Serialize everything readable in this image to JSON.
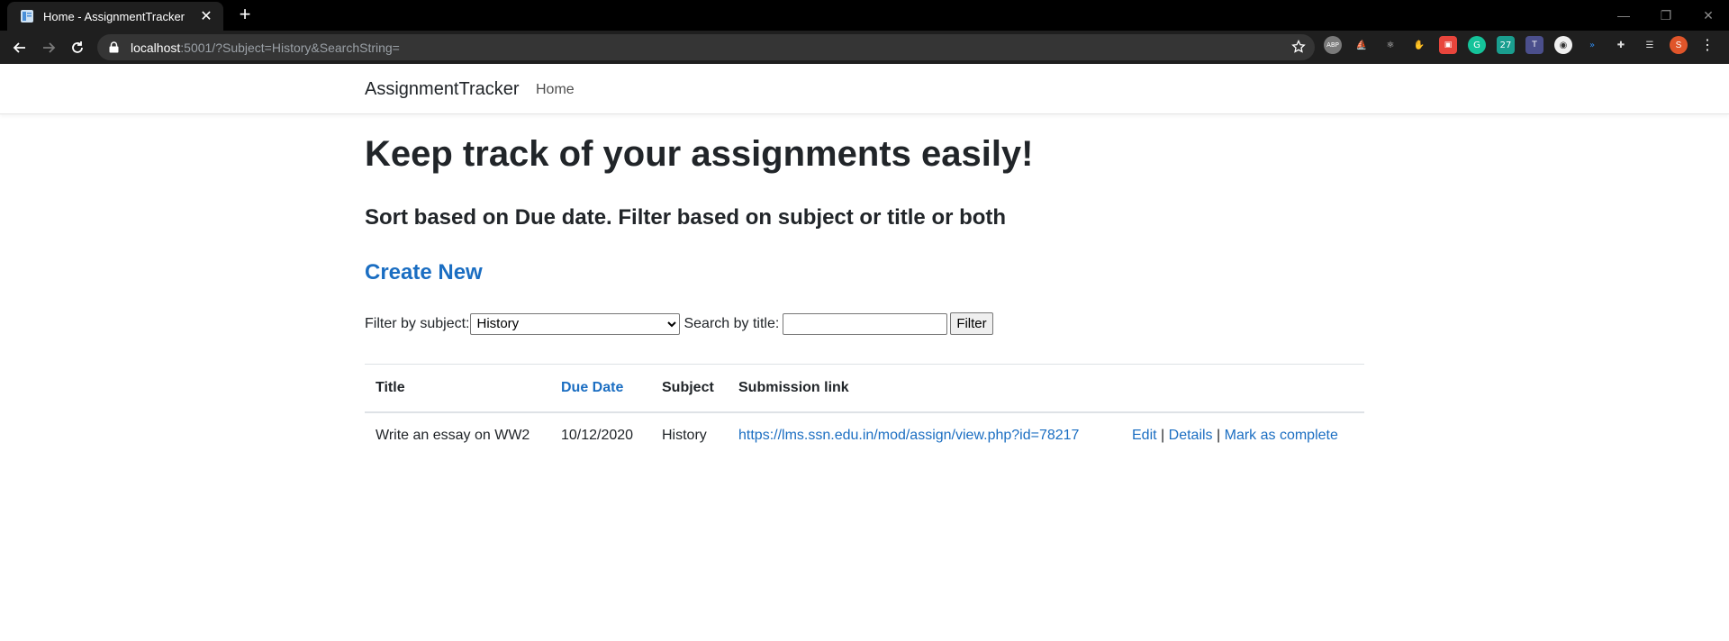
{
  "browser": {
    "tab_title": "Home - AssignmentTracker",
    "url_host": "localhost",
    "url_rest": ":5001/?Subject=History&SearchString=",
    "profile_initial": "S"
  },
  "navbar": {
    "brand": "AssignmentTracker",
    "home": "Home"
  },
  "page": {
    "heading": "Keep track of your assignments easily!",
    "subheading": "Sort based on Due date. Filter based on subject or title or both",
    "create_new": "Create New"
  },
  "filter": {
    "subject_label": "Filter by subject:",
    "subject_selected": "History",
    "title_label": "Search by title:",
    "title_value": "",
    "button": "Filter"
  },
  "table": {
    "headers": {
      "title": "Title",
      "due_date": "Due Date",
      "subject": "Subject",
      "submission_link": "Submission link"
    },
    "rows": [
      {
        "title": "Write an essay on WW2",
        "due_date": "10/12/2020",
        "subject": "History",
        "link": "https://lms.ssn.edu.in/mod/assign/view.php?id=78217",
        "edit": "Edit",
        "sep1": "|",
        "details": "Details",
        "sep2": "|",
        "complete": "Mark as complete"
      }
    ]
  }
}
